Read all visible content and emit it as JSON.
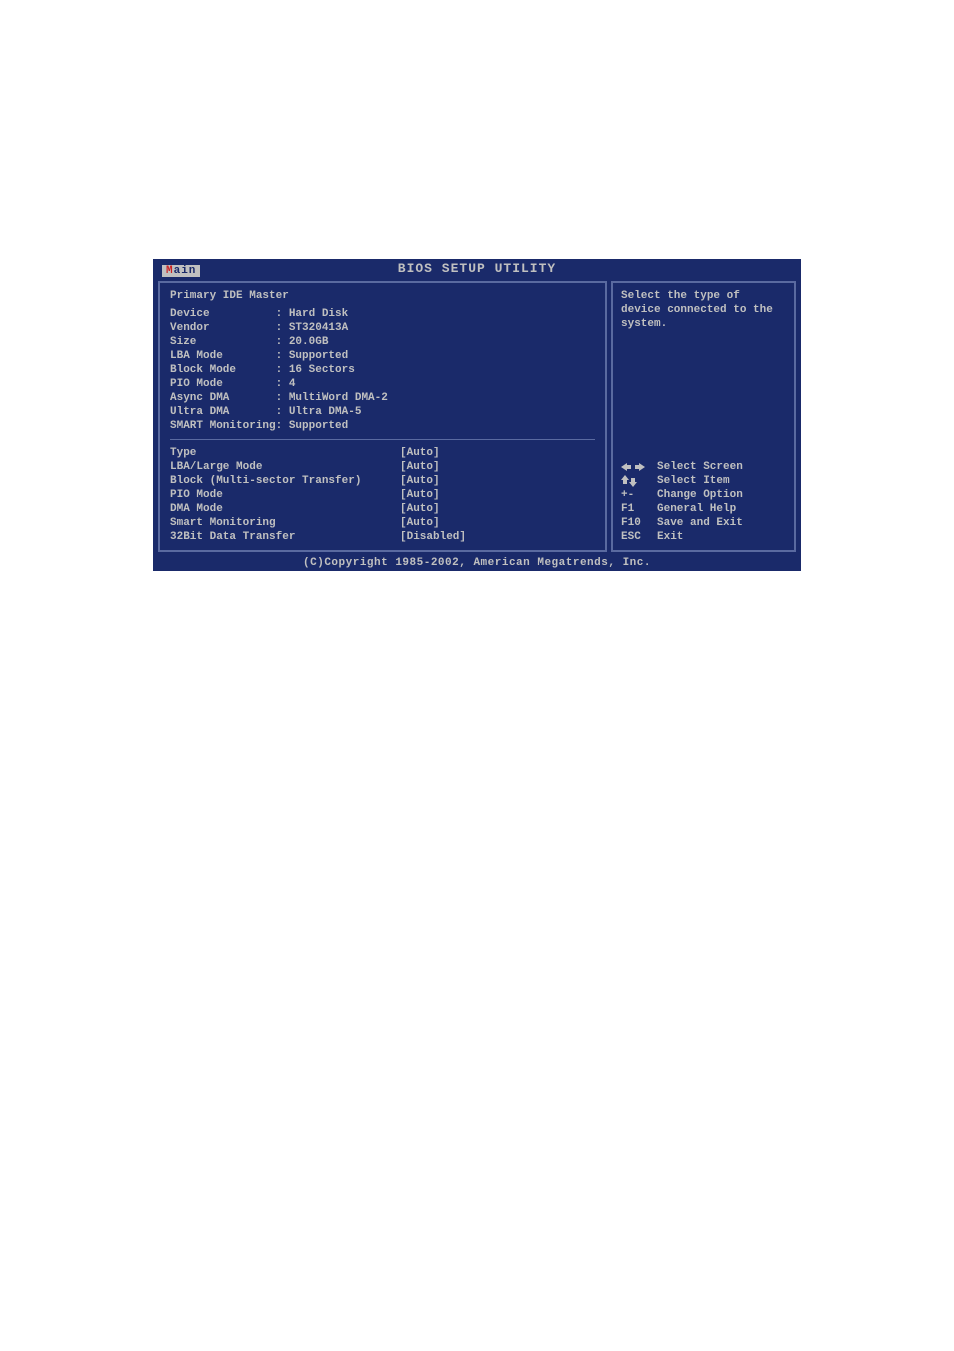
{
  "title": "BIOS SETUP UTILITY",
  "tab": {
    "accel": "M",
    "rest": "ain"
  },
  "section_title": "Primary IDE Master",
  "info": [
    {
      "label": "Device          ",
      "value": ": Hard Disk"
    },
    {
      "label": "Vendor          ",
      "value": ": ST320413A"
    },
    {
      "label": "Size            ",
      "value": ": 20.0GB"
    },
    {
      "label": "LBA Mode        ",
      "value": ": Supported"
    },
    {
      "label": "Block Mode      ",
      "value": ": 16 Sectors"
    },
    {
      "label": "PIO Mode        ",
      "value": ": 4"
    },
    {
      "label": "Async DMA       ",
      "value": ": MultiWord DMA-2"
    },
    {
      "label": "Ultra DMA       ",
      "value": ": Ultra DMA-5"
    },
    {
      "label": "SMART Monitoring",
      "value": ": Supported"
    }
  ],
  "settings": [
    {
      "label": "Type",
      "value": "[Auto]"
    },
    {
      "label": "LBA/Large Mode",
      "value": "[Auto]"
    },
    {
      "label": "Block (Multi-sector Transfer)",
      "value": "[Auto]"
    },
    {
      "label": "PIO Mode",
      "value": "[Auto]"
    },
    {
      "label": "DMA Mode",
      "value": "[Auto]"
    },
    {
      "label": "Smart Monitoring",
      "value": "[Auto]"
    },
    {
      "label": "32Bit Data Transfer",
      "value": "[Disabled]"
    }
  ],
  "help_text": "Select the type of device connected to the system.",
  "legend": [
    {
      "key_type": "left-right-arrows",
      "text": "Select Screen"
    },
    {
      "key_type": "up-down-arrows",
      "text": "Select Item"
    },
    {
      "key_type": "text",
      "key": "+-",
      "text": "Change Option"
    },
    {
      "key_type": "text",
      "key": "F1",
      "text": "General Help"
    },
    {
      "key_type": "text",
      "key": "F10",
      "text": "Save and Exit"
    },
    {
      "key_type": "text",
      "key": "ESC",
      "text": "Exit"
    }
  ],
  "footer": "(C)Copyright 1985-2002, American Megatrends, Inc."
}
